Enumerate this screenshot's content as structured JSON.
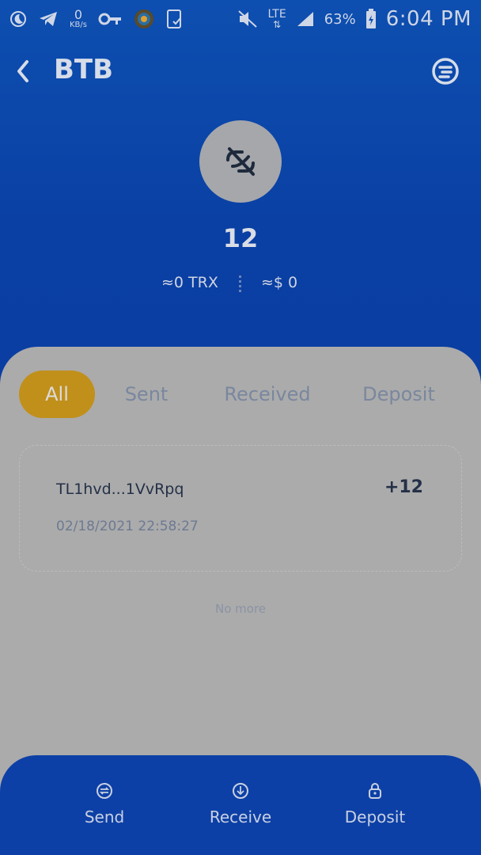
{
  "status_bar": {
    "data_speed": "0",
    "data_unit": "KB/s",
    "network": "LTE",
    "battery": "63%",
    "time": "6:04 PM"
  },
  "header": {
    "title": "BTB",
    "back_icon": "chevron-left-icon",
    "menu_icon": "menu-circle-icon"
  },
  "token": {
    "logo_icon": "crossed-chain-icon",
    "balance": "12",
    "trx_value": "≈0 TRX",
    "usd_value": "≈$ 0"
  },
  "tabs": [
    {
      "label": "All",
      "active": true
    },
    {
      "label": "Sent",
      "active": false
    },
    {
      "label": "Received",
      "active": false
    },
    {
      "label": "Deposit",
      "active": false
    }
  ],
  "transactions": [
    {
      "address": "TL1hvd...1VvRpq",
      "amount": "+12",
      "datetime": "02/18/2021 22:58:27"
    }
  ],
  "list_footer": "No more",
  "actions": [
    {
      "label": "Send",
      "icon": "swap-icon"
    },
    {
      "label": "Receive",
      "icon": "download-icon"
    },
    {
      "label": "Deposit",
      "icon": "lock-icon"
    }
  ],
  "colors": {
    "header_blue": "#0d4fb0",
    "active_tab": "#c1901b",
    "bottom_bar": "#0d40a6"
  }
}
